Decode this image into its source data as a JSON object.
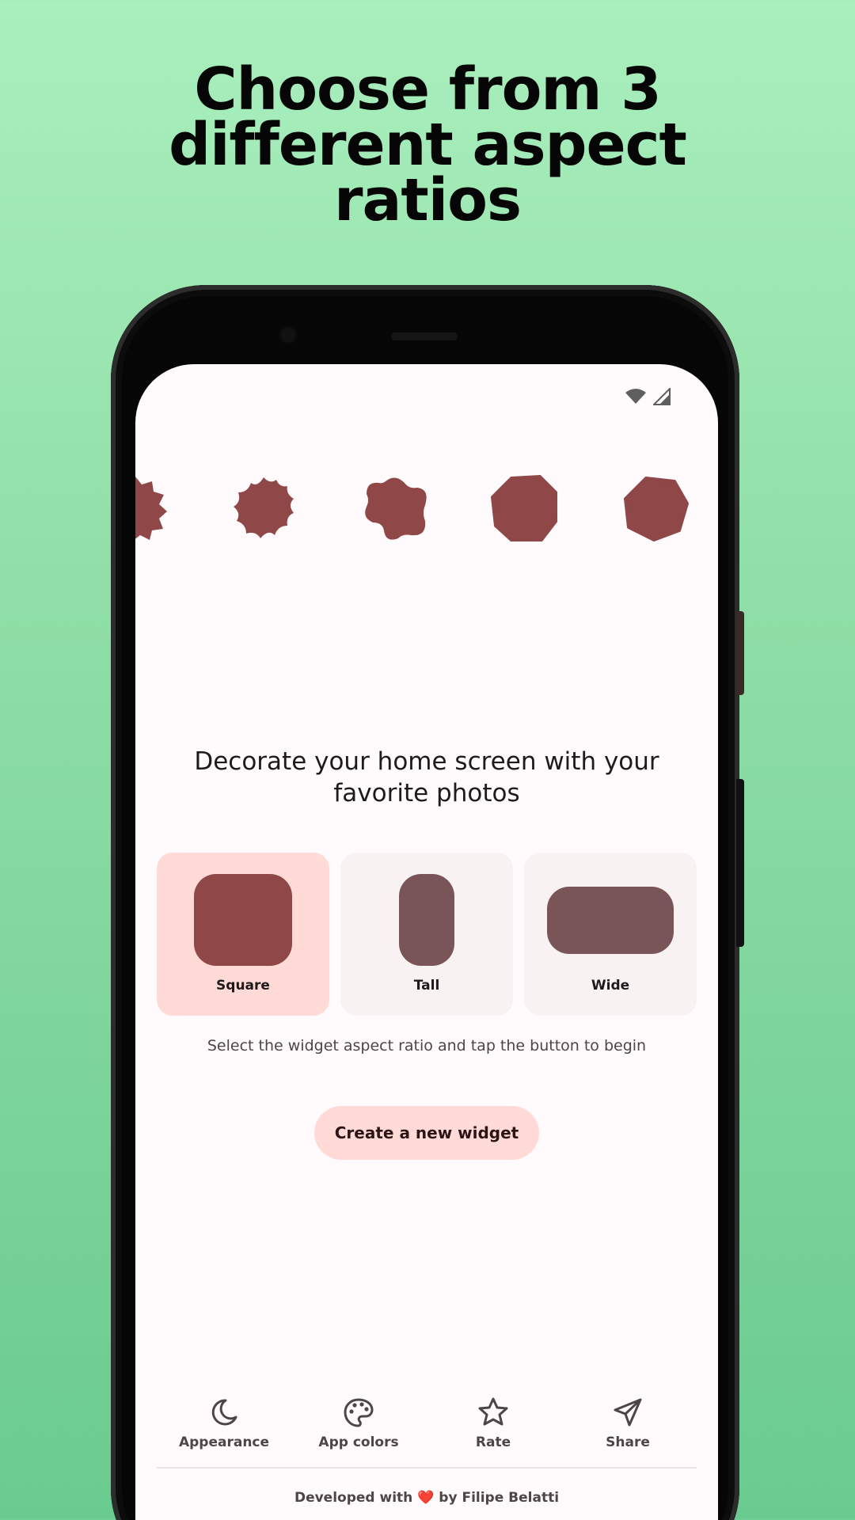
{
  "headline": {
    "line1": "Choose from 3",
    "line2": "different aspect",
    "line3": "ratios"
  },
  "colors": {
    "background_top": "#a9efbd",
    "background_bottom": "#6acb90",
    "shape_fill": "#8f4748",
    "card_selected": "#ffdad6",
    "card_default": "#f8f2f3",
    "preview_default": "#7a5557",
    "button_bg": "#ffdad6"
  },
  "status_bar": {
    "icons": [
      "wifi-icon",
      "cellular-signal-icon"
    ]
  },
  "shapes": [
    "scallop-shape",
    "flower-shape",
    "blob-shape",
    "octagon-shape",
    "heptagon-shape"
  ],
  "app": {
    "tagline": "Decorate your home screen with your favorite photos",
    "aspect_ratios": [
      {
        "label": "Square",
        "selected": true
      },
      {
        "label": "Tall",
        "selected": false
      },
      {
        "label": "Wide",
        "selected": false
      }
    ],
    "hint": "Select the widget aspect ratio and tap the button to begin",
    "create_button": "Create a new widget"
  },
  "bottom_nav": [
    {
      "label": "Appearance",
      "icon": "moon-icon"
    },
    {
      "label": "App colors",
      "icon": "palette-icon"
    },
    {
      "label": "Rate",
      "icon": "star-icon"
    },
    {
      "label": "Share",
      "icon": "send-icon"
    }
  ],
  "footer": {
    "prefix": "Developed with",
    "heart": "❤️",
    "suffix": "by Filipe Belatti"
  }
}
